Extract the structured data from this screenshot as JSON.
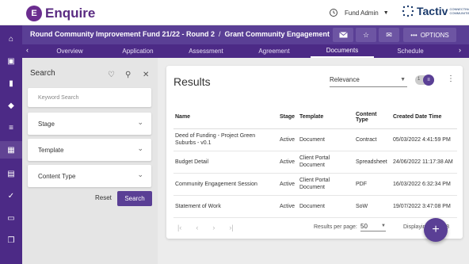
{
  "brand": {
    "logo_mark": "E",
    "name": "Enquire"
  },
  "user": {
    "name": "Fund Admin"
  },
  "partner": {
    "name": "Tactiv",
    "tagline": "CONNECTING COMMUNITIES"
  },
  "breadcrumb": {
    "fund": "Round Community Improvement Fund 21/22 - Round 2",
    "separator": "/",
    "item": "Grant Community Engagement"
  },
  "toolbar": {
    "options_label": "OPTIONS"
  },
  "tabs": [
    "Overview",
    "Application",
    "Assessment",
    "Agreement",
    "Documents",
    "Schedule"
  ],
  "active_tab": "Documents",
  "search": {
    "title": "Search",
    "keyword_placeholder": "Keyword Search",
    "filters": [
      "Stage",
      "Template",
      "Content Type"
    ],
    "reset_label": "Reset",
    "search_label": "Search"
  },
  "results": {
    "title": "Results",
    "sort": "Relevance",
    "sort_count": "1",
    "columns": [
      "Name",
      "Stage",
      "Template",
      "Content Type",
      "Created Date Time"
    ],
    "rows": [
      {
        "name": "Deed of Funding - Project Green Suburbs - v0.1",
        "stage": "Active",
        "template": "Document",
        "content_type": "Contract",
        "created": "05/03/2022 4:41:59 PM"
      },
      {
        "name": "Budget Detail",
        "stage": "Active",
        "template": "Client Portal Document",
        "content_type": "Spreadsheet",
        "created": "24/06/2022 11:17:38 AM"
      },
      {
        "name": "Community Engagement Session",
        "stage": "Active",
        "template": "Client Portal Document",
        "content_type": "PDF",
        "created": "16/03/2022 6:32:34 PM"
      },
      {
        "name": "Statement of Work",
        "stage": "Active",
        "template": "Document",
        "content_type": "SoW",
        "created": "19/07/2022 3:47:08 PM"
      }
    ],
    "results_per_page_label": "Results per page:",
    "results_per_page": "50",
    "displaying": "Displaying 1-4 of 8"
  },
  "colors": {
    "primary": "#4c2a86",
    "accent": "#5a3f95"
  }
}
